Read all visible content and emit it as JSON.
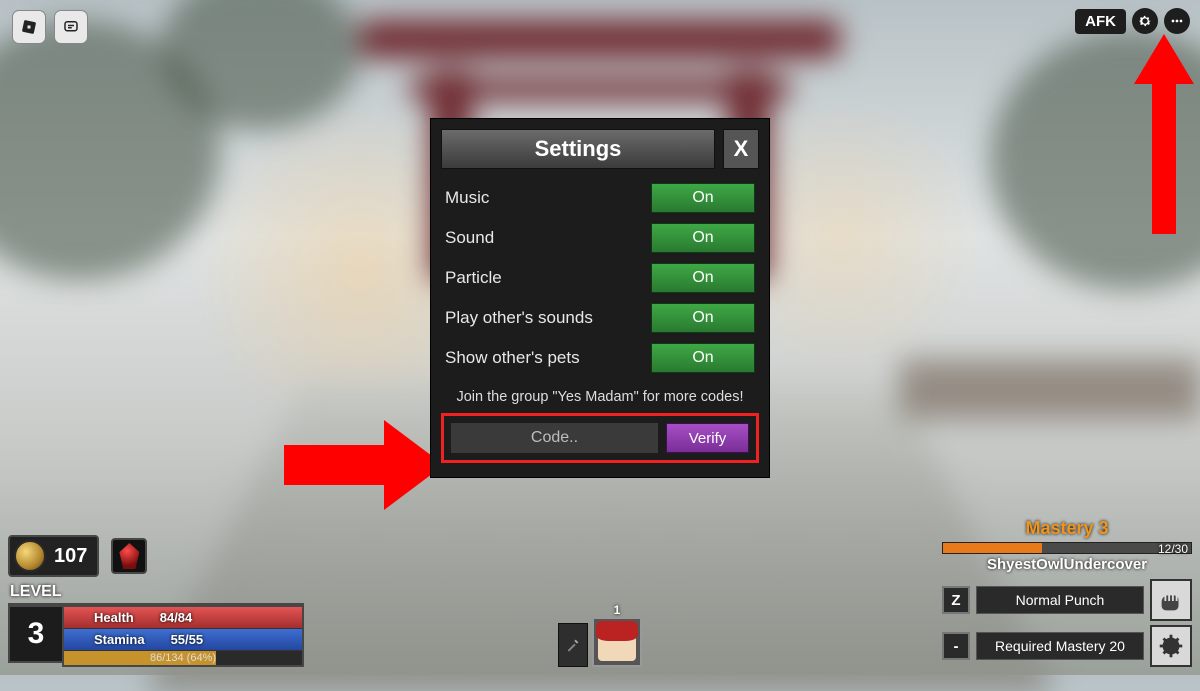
{
  "topbar": {
    "afk_label": "AFK"
  },
  "settings": {
    "title": "Settings",
    "close_label": "X",
    "options": [
      {
        "label": "Music",
        "value": "On"
      },
      {
        "label": "Sound",
        "value": "On"
      },
      {
        "label": "Particle",
        "value": "On"
      },
      {
        "label": "Play other's sounds",
        "value": "On"
      },
      {
        "label": "Show other's pets",
        "value": "On"
      }
    ],
    "hint": "Join the group \"Yes Madam\" for more codes!",
    "code_placeholder": "Code..",
    "verify_label": "Verify"
  },
  "hud": {
    "coins": "107",
    "level_label": "LEVEL",
    "level_value": "3",
    "health_label": "Health",
    "health_value": "84/84",
    "stamina_label": "Stamina",
    "stamina_value": "55/55",
    "xp_text": "86/134 (64%)",
    "avatar_slot_number": "1"
  },
  "right_hud": {
    "mastery_title": "Mastery 3",
    "mastery_progress": "12/30",
    "player_name": "ShyestOwlUndercover",
    "skills": [
      {
        "key": "Z",
        "label": "Normal Punch"
      },
      {
        "key": "-",
        "label": "Required Mastery 20"
      }
    ]
  },
  "colors": {
    "accent_green": "#2f8f37",
    "accent_purple": "#8a3aa8",
    "accent_orange": "#e87a1a",
    "annotation_red": "#ff0000"
  }
}
